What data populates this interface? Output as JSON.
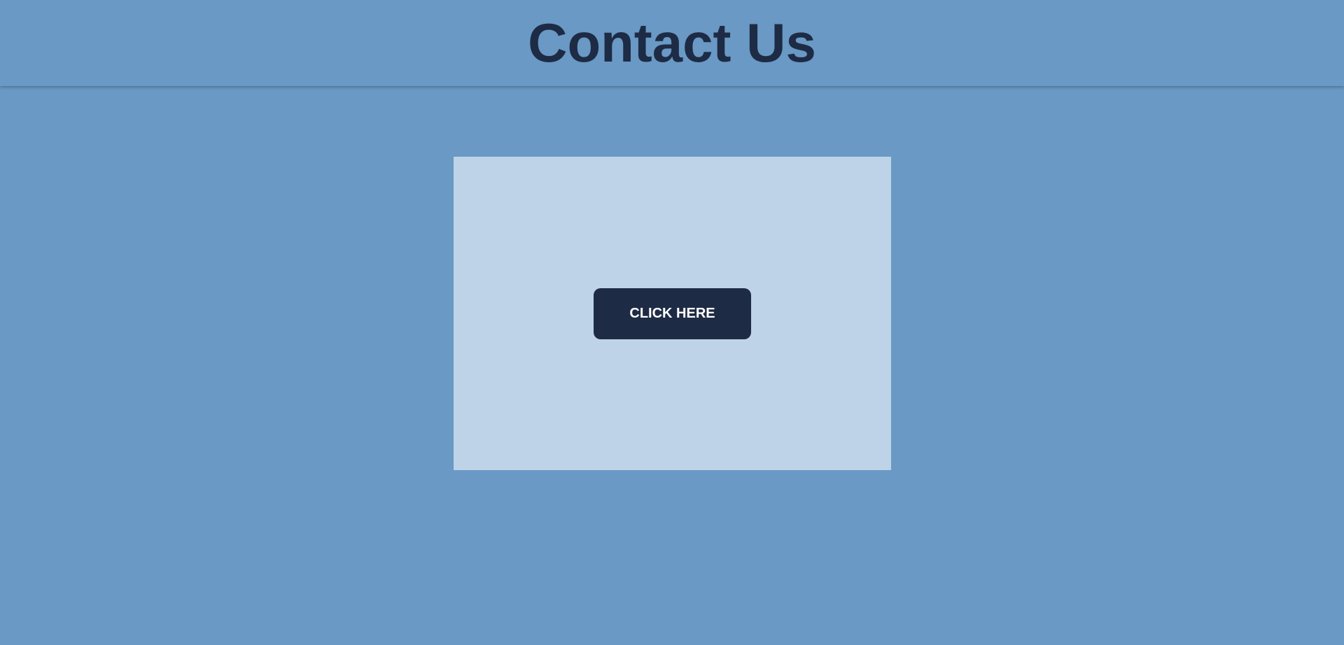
{
  "header": {
    "title": "Contact Us"
  },
  "card": {
    "button_label": "CLICK HERE"
  },
  "colors": {
    "background": "#6999c4",
    "card": "#bed3e7",
    "title": "#1e2b45",
    "button": "#1e2b45",
    "button_text": "#ffffff"
  }
}
